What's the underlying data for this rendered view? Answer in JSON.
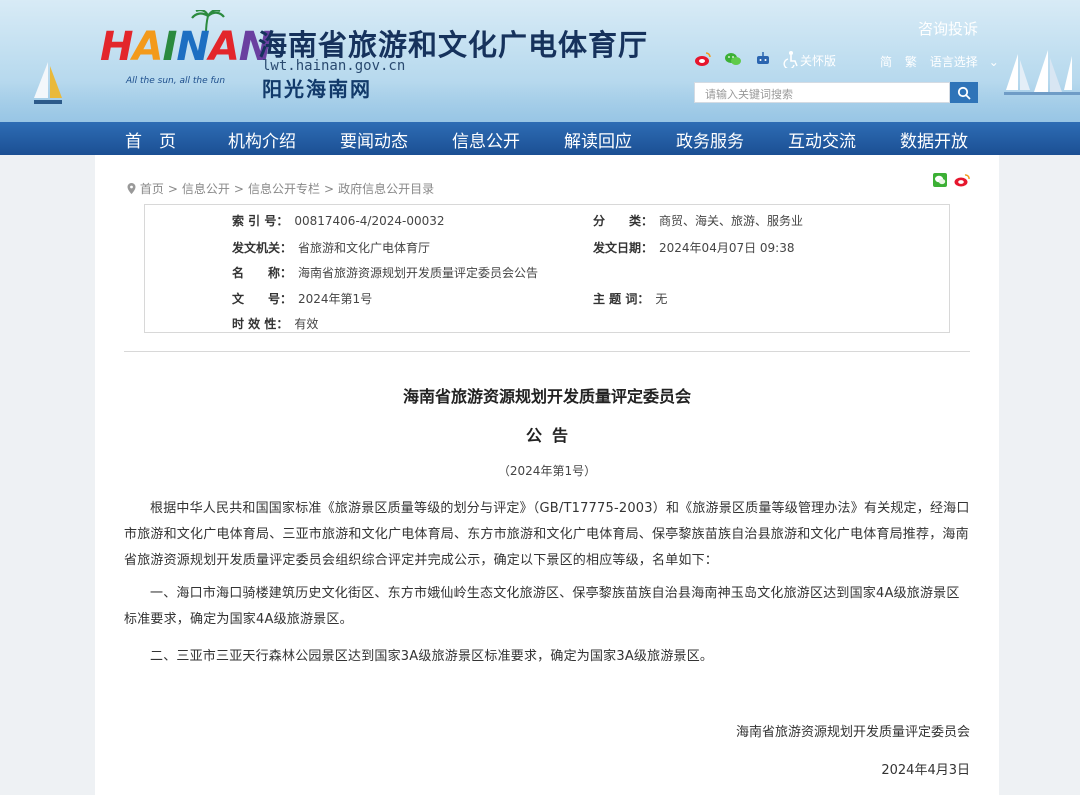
{
  "header": {
    "logo_text": "HAINAN",
    "logo_slogan": "All the sun, all the fun",
    "title": "海南省旅游和文化广电体育厅",
    "domain": "lwt.hainan.gov.cn",
    "subtitle": "阳光海南网",
    "consult": "咨询投诉",
    "care_mode": "关怀版",
    "lang_simplified": "简",
    "lang_traditional": "繁",
    "lang_select": "语言选择",
    "search_placeholder": "请输入关键词搜索"
  },
  "nav": [
    "首　页",
    "机构介绍",
    "要闻动态",
    "信息公开",
    "解读回应",
    "政务服务",
    "互动交流",
    "数据开放"
  ],
  "breadcrumb": [
    "首页",
    "信息公开",
    "信息公开专栏",
    "政府信息公开目录"
  ],
  "meta": {
    "index_no_label": "索 引 号：",
    "index_no": "00817406-4/2024-00032",
    "category_label": "分　　类：",
    "category": "商贸、海关、旅游、服务业",
    "issuer_label": "发文机关：",
    "issuer": "省旅游和文化广电体育厅",
    "date_label": "发文日期：",
    "date": "2024年04月07日 09:38",
    "name_label": "名　　称：",
    "name": "海南省旅游资源规划开发质量评定委员会公告",
    "doc_no_label": "文　　号：",
    "doc_no": "2024年第1号",
    "subject_label": "主 题 词：",
    "subject": "无",
    "validity_label": "时 效 性：",
    "validity": "有效"
  },
  "article": {
    "title": "海南省旅游资源规划开发质量评定委员会",
    "subtitle": "公告",
    "number": "（2024年第1号）",
    "p1": "根据中华人民共和国国家标准《旅游景区质量等级的划分与评定》（GB/T17775-2003）和《旅游景区质量等级管理办法》有关规定，经海口市旅游和文化广电体育局、三亚市旅游和文化广电体育局、东方市旅游和文化广电体育局、保亭黎族苗族自治县旅游和文化广电体育局推荐，海南省旅游资源规划开发质量评定委员会组织综合评定并完成公示，确定以下景区的相应等级，名单如下：",
    "p2": "一、海口市海口骑楼建筑历史文化街区、东方市娥仙岭生态文化旅游区、保亭黎族苗族自治县海南神玉岛文化旅游区达到国家4A级旅游景区标准要求，确定为国家4A级旅游景区。",
    "p3": "二、三亚市三亚天行森林公园景区达到国家3A级旅游景区标准要求，确定为国家3A级旅游景区。",
    "sign_org": "海南省旅游资源规划开发质量评定委员会",
    "sign_date": "2024年4月3日"
  },
  "colors": {
    "nav_bg": "#1f5aa0",
    "header_bg": "#bcdcef",
    "page_bg": "#eef1f4"
  },
  "icons": [
    "palm-tree-icon",
    "weibo-icon",
    "wechat-icon",
    "robot-icon",
    "accessibility-icon",
    "search-icon",
    "location-pin-icon",
    "wechat-share-icon",
    "weibo-share-icon"
  ]
}
